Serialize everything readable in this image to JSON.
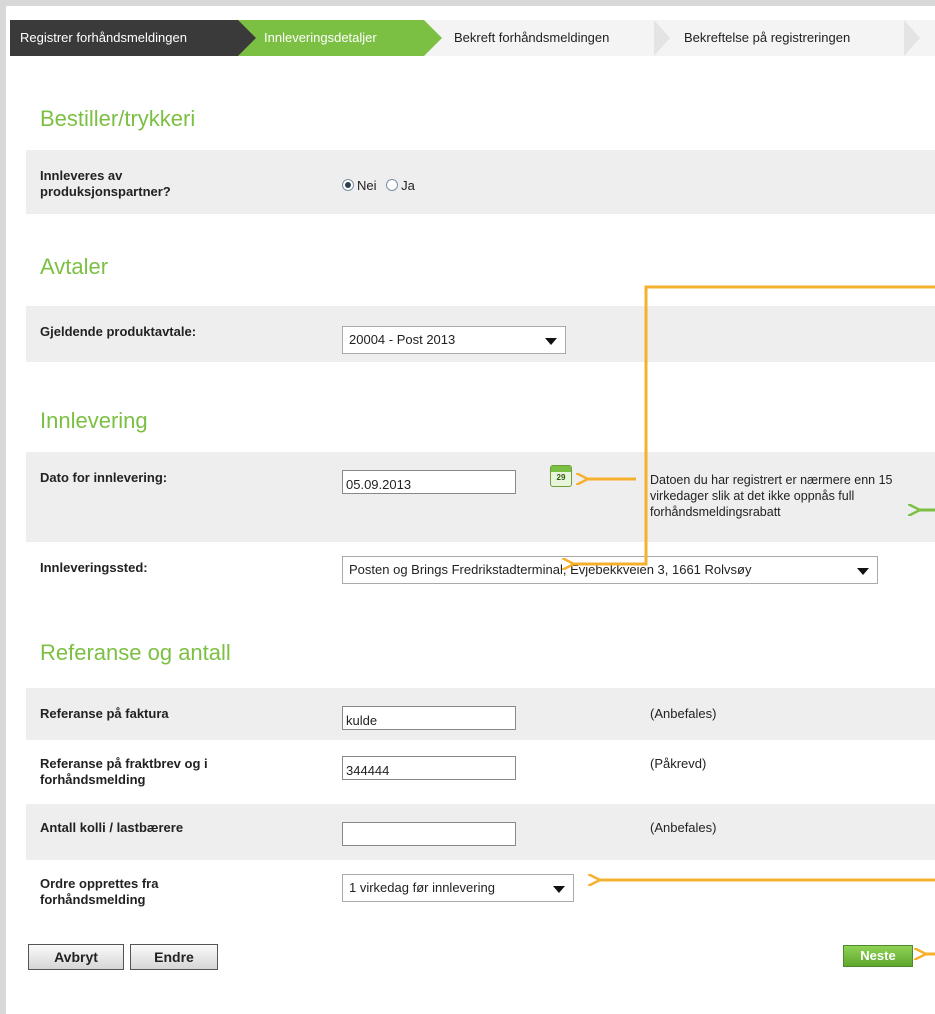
{
  "steps": [
    {
      "label": "Registrer forhåndsmeldingen"
    },
    {
      "label": "Innleveringsdetaljer"
    },
    {
      "label": "Bekreft forhåndsmeldingen"
    },
    {
      "label": "Bekreftelse på registreringen"
    }
  ],
  "bestiller": {
    "title": "Bestiller/trykkeri",
    "partner_label": "Innleveres av produksjonspartner?",
    "option_no": "Nei",
    "option_yes": "Ja",
    "selected": "Nei"
  },
  "avtaler": {
    "title": "Avtaler",
    "product_label": "Gjeldende produktavtale:",
    "product_value": "20004 - Post 2013"
  },
  "innlevering": {
    "title": "Innlevering",
    "date_label": "Dato for innlevering:",
    "date_value": "05.09.2013",
    "calendar_day": "29",
    "date_notice": "Datoen du har registrert er nærmere enn 15 virkedager slik at det ikke oppnås full forhåndsmeldingsrabatt",
    "place_label": "Innleveringssted:",
    "place_value": "Posten og Brings Fredrikstadterminal, Evjebekkveien 3, 1661 Rolvsøy"
  },
  "referanse": {
    "title": "Referanse og antall",
    "invoice_label": "Referanse på faktura",
    "invoice_value": "kulde",
    "invoice_hint": "(Anbefales)",
    "freight_label": "Referanse på fraktbrev og i forhåndsmelding",
    "freight_value": "344444",
    "freight_hint": "(Påkrevd)",
    "parcels_label": "Antall kolli / lastbærere",
    "parcels_value": "",
    "parcels_hint": "(Anbefales)",
    "order_label": "Ordre opprettes fra forhåndsmelding",
    "order_value": "1 virkedag før innlevering"
  },
  "buttons": {
    "cancel": "Avbryt",
    "edit": "Endre",
    "next": "Neste"
  },
  "colors": {
    "accent_green": "#7cc043",
    "dark_step": "#3a3a3a",
    "annotation_orange": "#f5b02e",
    "annotation_green": "#7cc043"
  }
}
